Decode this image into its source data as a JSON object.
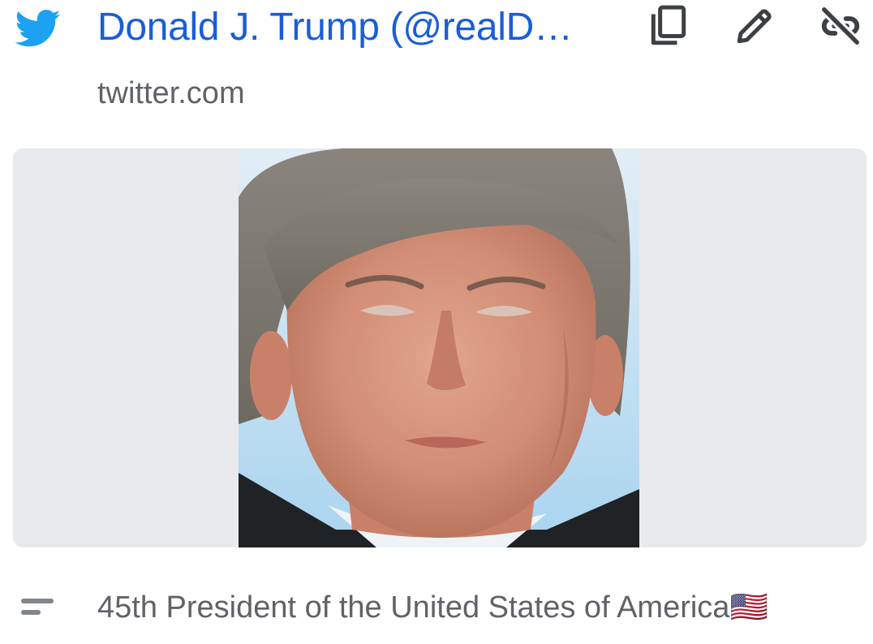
{
  "link": {
    "site_icon": "twitter-bird-icon",
    "title": "Donald J. Trump (@realD…",
    "domain": "twitter.com",
    "description": "45th President of the United States of America🇺🇸"
  },
  "actions": [
    {
      "icon": "copy-icon"
    },
    {
      "icon": "pencil-icon"
    },
    {
      "icon": "unlink-icon"
    }
  ],
  "preview": {
    "image": "portrait-photo"
  },
  "colors": {
    "title_link": "#1a5dd8",
    "secondary_text": "#5f6368",
    "preview_bg": "#e8eaed",
    "twitter_blue": "#1da1f2",
    "icon_gray": "#3c4043"
  }
}
